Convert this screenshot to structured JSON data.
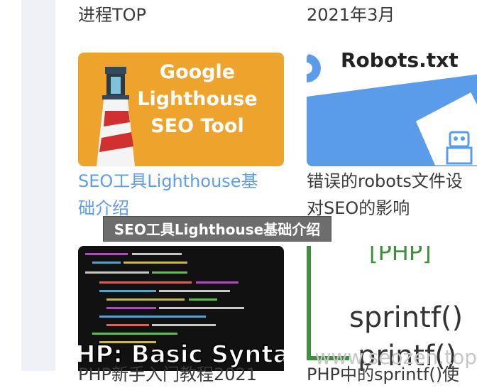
{
  "cards": [
    {
      "title_line1": "进程TOP"
    },
    {
      "title_line1": "2021年3月"
    },
    {
      "thumb_lines": [
        "Google",
        "Lighthouse",
        "SEO Tool"
      ],
      "title_line1": "SEO工具Lighthouse基",
      "title_line2": "础介绍",
      "icon": "lighthouse-icon"
    },
    {
      "thumb_text": "Robots.txt",
      "title_line1": "错误的robots文件设",
      "title_line2": "对SEO的影响",
      "icon": "robot-icon"
    },
    {
      "thumb_text": "HP: Basic Synta",
      "title_line1": "PHP新手入门教程2021",
      "icon": "code-editor-image"
    },
    {
      "thumb_lines": [
        "[PHP]",
        "sprintf()",
        "printf()"
      ],
      "title_line1": "PHP中的sprintf()使"
    }
  ],
  "tooltip": "SEO工具Lighthouse基础介绍",
  "watermark": "www.seozen.top",
  "colors": {
    "link": "#5d9df0",
    "rail": "#eff1f6",
    "orange": "#eea42c",
    "blue": "#5b9cea",
    "green": "#3f8f3f"
  }
}
